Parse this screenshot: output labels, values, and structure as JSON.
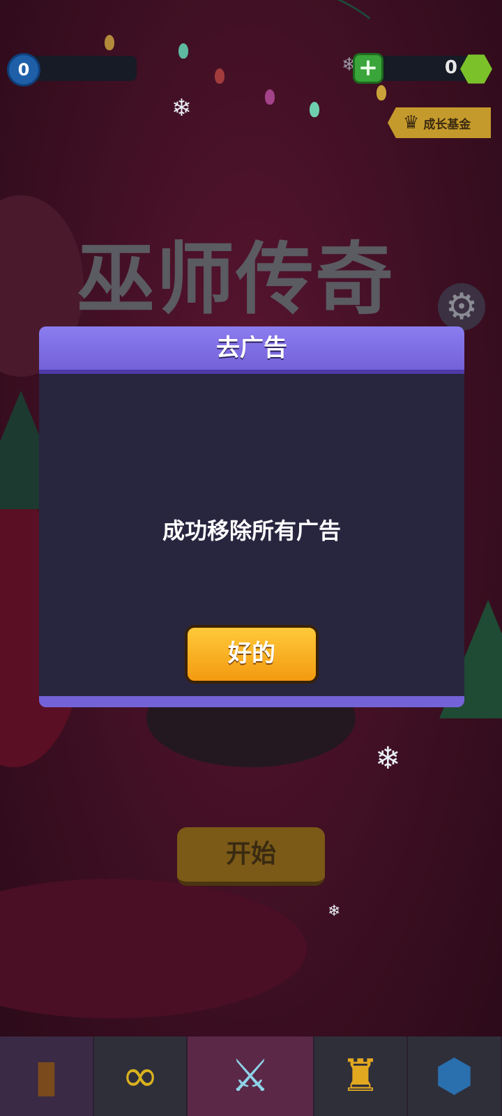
{
  "hud": {
    "level": "0",
    "gems": "0",
    "plus_glyph": "+",
    "growth_fund_label": "成长基金"
  },
  "background": {
    "logo_text": "巫师传奇",
    "start_label": "开始"
  },
  "dialog": {
    "title": "去广告",
    "message": "成功移除所有广告",
    "ok_label": "好的"
  },
  "bottom_nav": {
    "tabs": [
      {
        "name": "shop",
        "icon": "cabinet-icon"
      },
      {
        "name": "endless",
        "icon": "infinity-icon"
      },
      {
        "name": "battle",
        "icon": "crossed-swords-icon"
      },
      {
        "name": "leaderboard",
        "icon": "trophy-icon"
      },
      {
        "name": "clan",
        "icon": "shield-banner-icon"
      }
    ]
  },
  "colors": {
    "dialog_header": "#7462d8",
    "dialog_body": "#28253f",
    "ok_button": "#f7a91e",
    "background": "#3d0f22"
  }
}
